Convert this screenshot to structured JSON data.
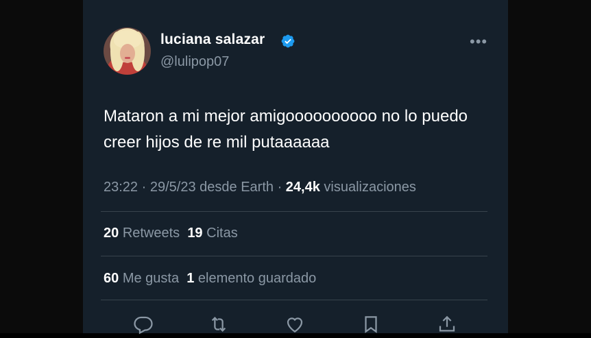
{
  "user": {
    "name": "luciana salazar",
    "handle": "@lulipop07",
    "verified": true
  },
  "tweet": {
    "text": "Mataron a mi mejor amigoooooooooo no lo puedo creer hijos de re mil putaaaaaa",
    "time": "23:22",
    "date": "29/5/23",
    "source": "desde Earth",
    "views_count": "24,4k",
    "views_label": "visualizaciones"
  },
  "stats": {
    "retweets_count": "20",
    "retweets_label": "Retweets",
    "quotes_count": "19",
    "quotes_label": "Citas",
    "likes_count": "60",
    "likes_label": "Me gusta",
    "bookmarks_count": "1",
    "bookmarks_label": "elemento guardado"
  },
  "icons": {
    "more": "more-icon",
    "reply": "reply-icon",
    "retweet": "retweet-icon",
    "like": "like-icon",
    "bookmark": "bookmark-icon",
    "share": "share-icon",
    "verified": "verified-badge-icon"
  },
  "colors": {
    "background": "#15202b",
    "muted_text": "#8b98a5",
    "verified_blue": "#1d9bf0",
    "divider": "#38444d"
  }
}
